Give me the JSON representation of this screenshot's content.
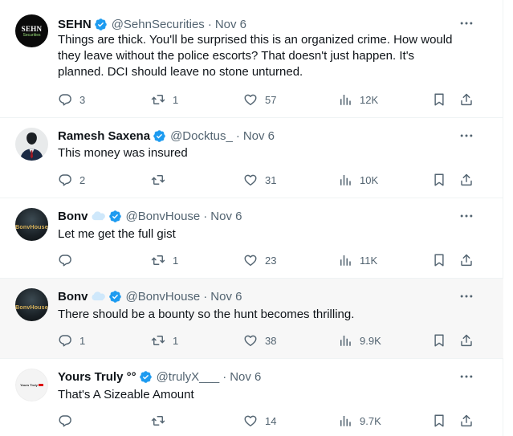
{
  "colors": {
    "verified": "#1d9bf0",
    "text": "#0f1419",
    "muted": "#536471",
    "divider": "#eff3f4",
    "highlight": "#f7f7f7"
  },
  "tweets": [
    {
      "avatar_text": "SEHN",
      "avatar_sub": "Securities",
      "name": "SEHN",
      "handle": "@SehnSecurities",
      "date": "Nov 6",
      "lines": [
        "Things are thick. You'll be surprised this is an organized crime. How would",
        "they leave without the police escorts? That doesn't just happen. It's",
        "planned. DCI should leave no stone unturned."
      ],
      "replies": "3",
      "reposts": "1",
      "likes": "57",
      "views": "12K"
    },
    {
      "name": "Ramesh Saxena",
      "handle": "@Docktus_",
      "date": "Nov 6",
      "lines": [
        "This money was insured"
      ],
      "replies": "2",
      "reposts": "",
      "likes": "31",
      "views": "10K"
    },
    {
      "avatar_text": "BonvHouse",
      "name": "Bonv",
      "handle": "@BonvHouse",
      "date": "Nov 6",
      "lines": [
        "Let me get the full gist"
      ],
      "replies": "",
      "reposts": "1",
      "likes": "23",
      "views": "11K"
    },
    {
      "avatar_text": "BonvHouse",
      "name": "Bonv",
      "handle": "@BonvHouse",
      "date": "Nov 6",
      "lines": [
        "There should be a bounty so the hunt becomes thrilling."
      ],
      "replies": "1",
      "reposts": "1",
      "likes": "38",
      "views": "9.9K"
    },
    {
      "avatar_text": "Yours Truly",
      "name": "Yours Truly °°",
      "handle": "@trulyX___",
      "date": "Nov 6",
      "lines": [
        "That's A Sizeable Amount"
      ],
      "replies": "",
      "reposts": "",
      "likes": "14",
      "views": "9.7K"
    }
  ]
}
